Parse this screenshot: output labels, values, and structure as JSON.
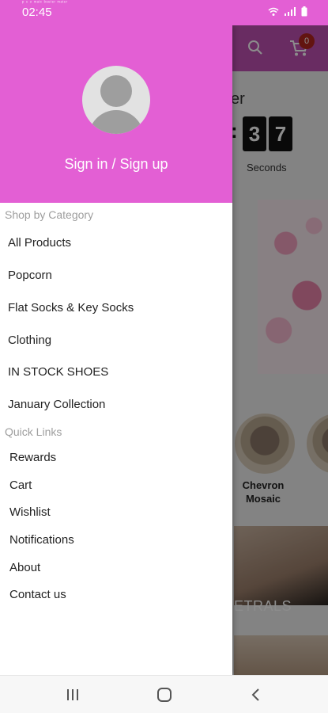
{
  "status_bar": {
    "time": "02:45",
    "tiny_text": "ᵖ ⁿ ᵒ ᵐᵃᴵᶜ ᵇᵉᵉᵗᵉʳ ᵐᵃᵗᵉʳ"
  },
  "background": {
    "cart_count": "0",
    "countdown_title": "er",
    "countdown_digits": [
      "3",
      "7"
    ],
    "countdown_unit": "Seconds",
    "category_label": "Chevron Mosaic",
    "banner_text": "ETRALS"
  },
  "drawer": {
    "signin_label": "Sign in / Sign up",
    "shop_by_category_label": "Shop by Category",
    "categories": [
      "All Products",
      "Popcorn",
      "Flat Socks & Key Socks",
      "Clothing",
      "IN STOCK SHOES",
      "January Collection"
    ],
    "quick_links_label": "Quick Links",
    "quick_links": [
      "Rewards",
      "Cart",
      "Wishlist",
      "Notifications",
      "About",
      "Contact us"
    ]
  },
  "colors": {
    "drawer_header": "#e35fd4",
    "app_bar": "#c051b2",
    "badge": "#b3261e"
  },
  "icons": {
    "search": "search-icon",
    "cart": "cart-icon",
    "avatar": "avatar-placeholder-icon",
    "nav_recent": "recent-apps-icon",
    "nav_home": "home-icon",
    "nav_back": "back-icon"
  }
}
